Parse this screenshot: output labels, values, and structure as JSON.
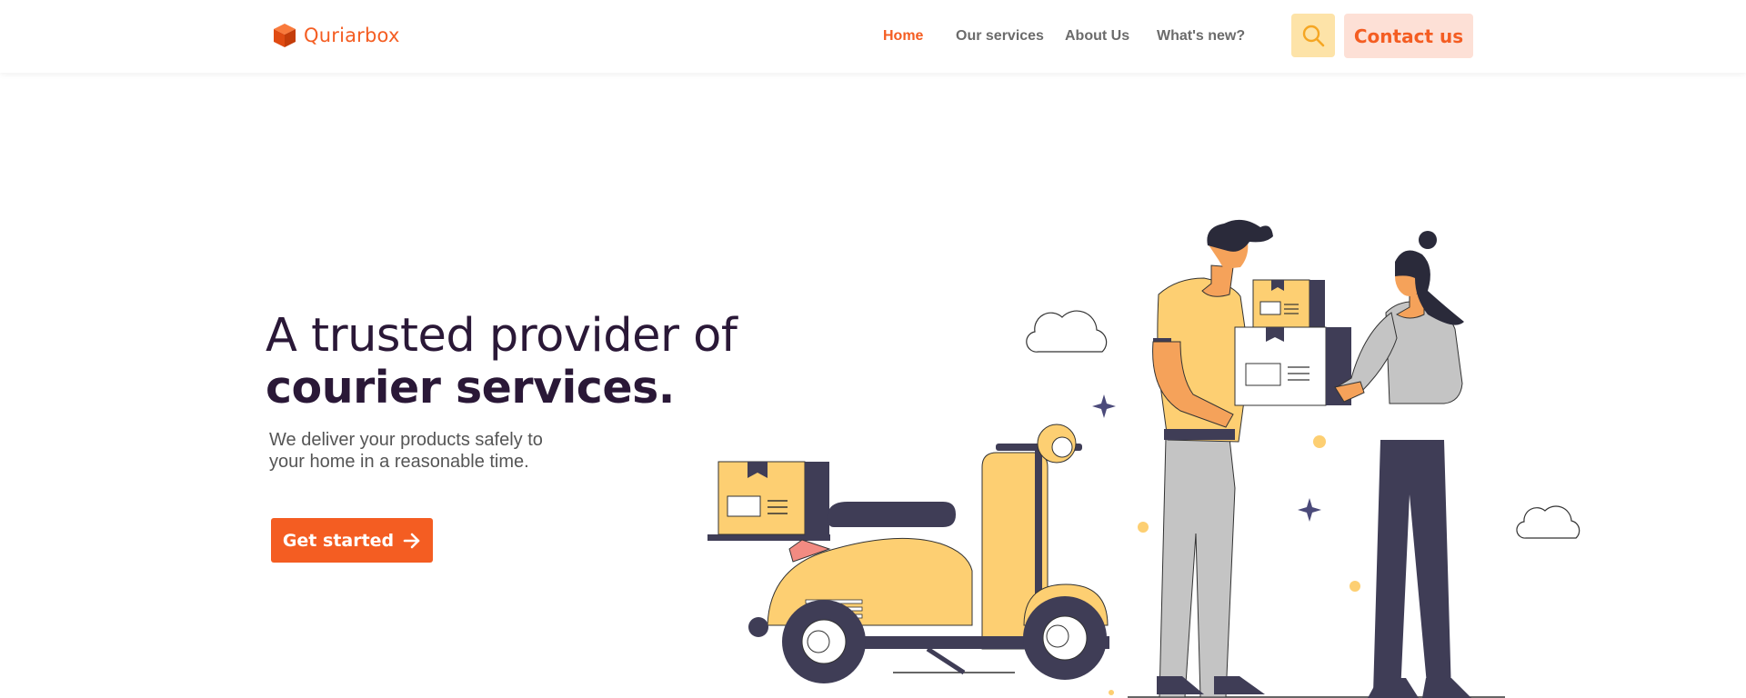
{
  "brand": {
    "name": "Quriarbox",
    "color": "#f45d22"
  },
  "nav": {
    "links": [
      {
        "label": "Home",
        "active": true
      },
      {
        "label": "Our services",
        "active": false
      },
      {
        "label": "About Us",
        "active": false
      },
      {
        "label": "What's new?",
        "active": false
      }
    ],
    "search_icon": "search-icon",
    "contact_label": "Contact us"
  },
  "hero": {
    "title_line1": "A trusted provider of",
    "title_line2": "courier services.",
    "subtitle_line1": "We deliver your products safely to",
    "subtitle_line2": "your home in a reasonable time.",
    "cta_label": "Get started",
    "cta_icon": "arrow-right-icon"
  },
  "colors": {
    "accent": "#f45d22",
    "dark": "#2a1837",
    "yellow": "#fdcf72",
    "navy": "#3f3d56",
    "search_bg": "#fde3a8",
    "contact_bg": "#fde0d6"
  }
}
